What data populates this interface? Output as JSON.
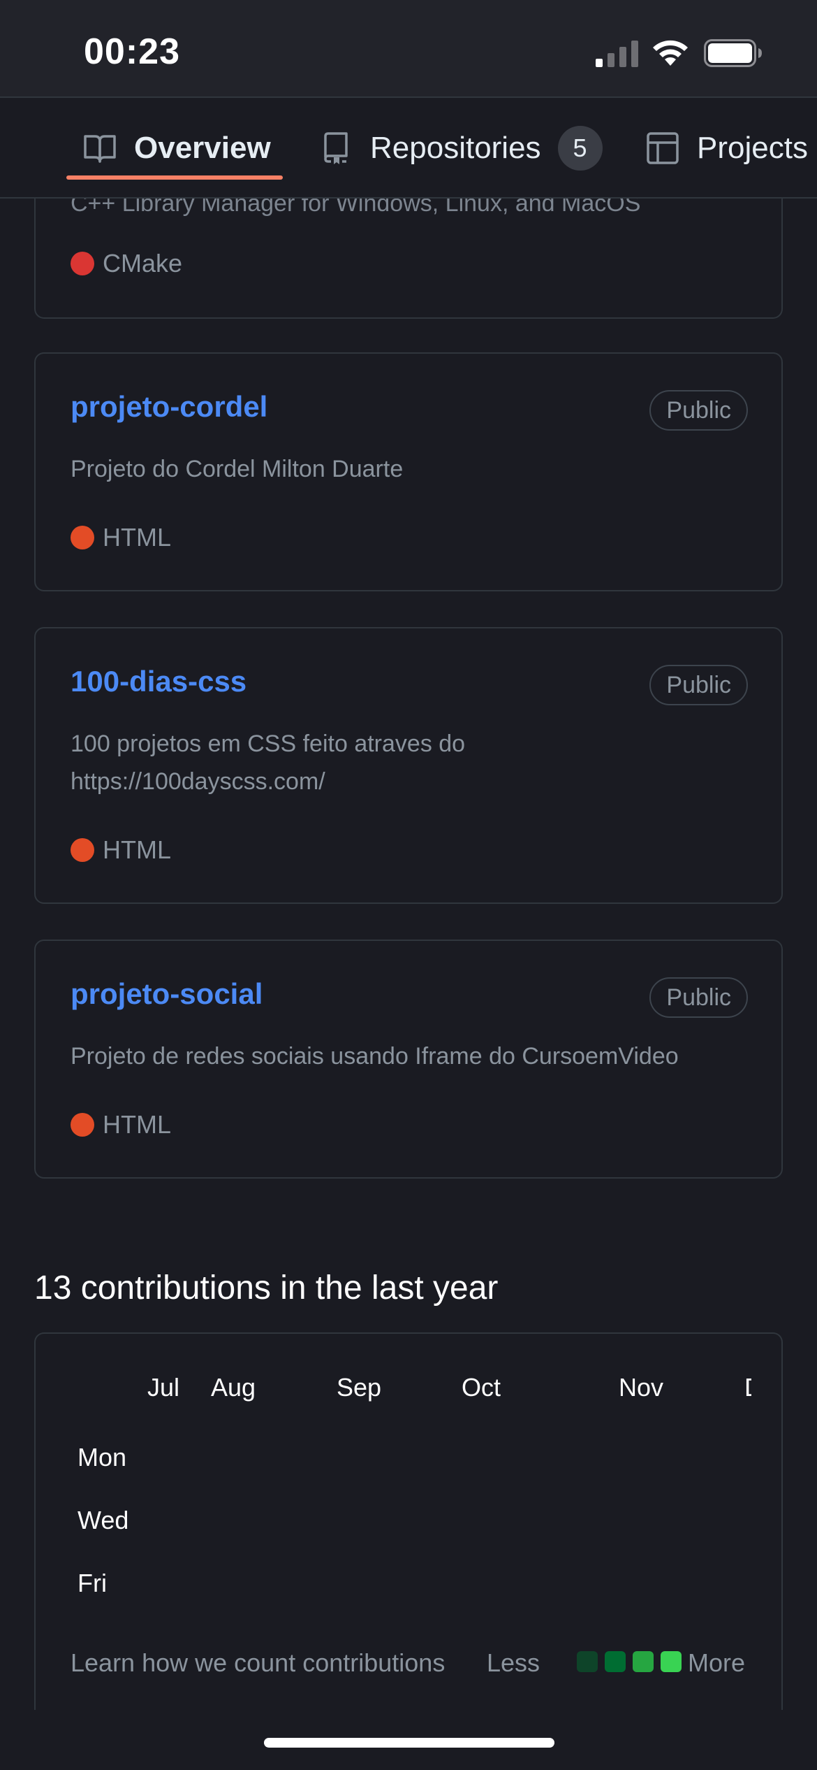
{
  "status_bar": {
    "time": "00:23"
  },
  "tabs": [
    {
      "label": "Overview",
      "icon": "book-icon",
      "selected": true
    },
    {
      "label": "Repositories",
      "icon": "repo-icon",
      "count": "5"
    },
    {
      "label": "Projects",
      "icon": "project-table-icon"
    }
  ],
  "clipped_card": {
    "description": "C++ Library Manager for Windows, Linux, and MacOS",
    "language": "CMake",
    "language_color": "#da3633"
  },
  "repos": [
    {
      "name": "projeto-cordel",
      "visibility": "Public",
      "description": "Projeto do Cordel Milton Duarte",
      "language": "HTML",
      "language_color": "#e34c26"
    },
    {
      "name": "100-dias-css",
      "visibility": "Public",
      "description": "100 projetos em CSS feito atraves do https://100dayscss.com/",
      "language": "HTML",
      "language_color": "#e34c26"
    },
    {
      "name": "projeto-social",
      "visibility": "Public",
      "description": "Projeto de redes sociais usando Iframe do CursoemVideo",
      "language": "HTML",
      "language_color": "#e34c26"
    }
  ],
  "contributions": {
    "title": "13 contributions in the last year",
    "months": [
      "Jul",
      "Aug",
      "Sep",
      "Oct",
      "Nov",
      "D"
    ],
    "days": [
      "Mon",
      "Wed",
      "Fri"
    ],
    "learn_link": "Learn how we count contributions",
    "less_label": "Less",
    "more_label": "More",
    "legend_colors": [
      "#0e4429",
      "#006d32",
      "#26a641",
      "#39d353"
    ]
  }
}
